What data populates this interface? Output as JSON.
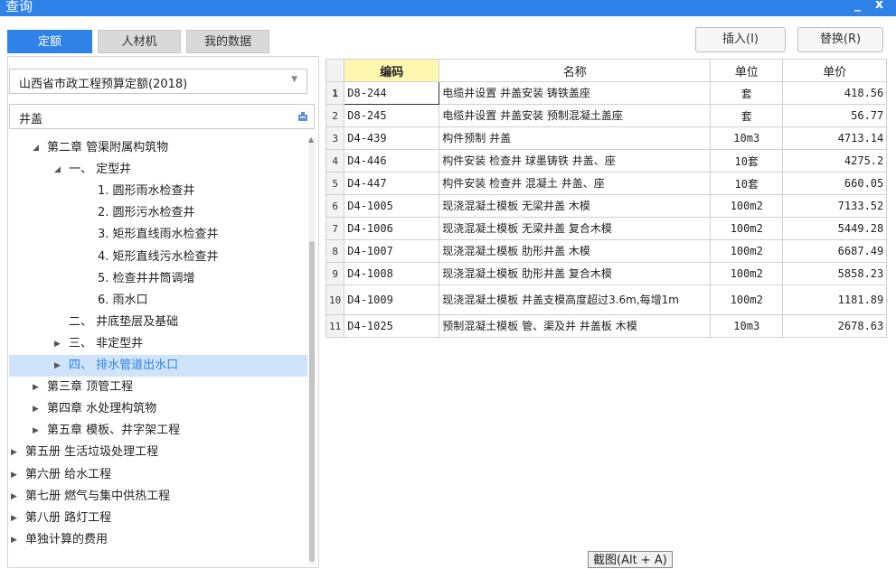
{
  "window": {
    "title": "查询",
    "minimize": "_",
    "close": "x"
  },
  "tabs": [
    {
      "label": "定额",
      "active": true
    },
    {
      "label": "人材机",
      "active": false
    },
    {
      "label": "我的数据",
      "active": false
    }
  ],
  "actions": {
    "insert": "插入(I)",
    "replace": "替换(R)"
  },
  "selector": {
    "value": "山西省市政工程预算定额(2018)"
  },
  "search": {
    "value": "井盖",
    "icon": "search-icon"
  },
  "tree": [
    {
      "toggle": "◢",
      "label": "第二章 管渠附属构筑物",
      "level": 2
    },
    {
      "toggle": "◢",
      "label": "一、 定型井",
      "level": 3
    },
    {
      "toggle": "",
      "label": "1. 圆形雨水检查井",
      "level": 4
    },
    {
      "toggle": "",
      "label": "2. 圆形污水检查井",
      "level": 4
    },
    {
      "toggle": "",
      "label": "3. 矩形直线雨水检查井",
      "level": 4
    },
    {
      "toggle": "",
      "label": "4. 矩形直线污水检查井",
      "level": 4
    },
    {
      "toggle": "",
      "label": "5. 检查井井筒调增",
      "level": 4
    },
    {
      "toggle": "",
      "label": "6. 雨水口",
      "level": 4
    },
    {
      "toggle": "",
      "label": "二、 井底垫层及基础",
      "level": 3
    },
    {
      "toggle": "▶",
      "label": "三、 非定型井",
      "level": 3
    },
    {
      "toggle": "▶",
      "label": "四、 排水管道出水口",
      "level": 3,
      "selected": true
    },
    {
      "toggle": "▶",
      "label": "第三章 顶管工程",
      "level": 2
    },
    {
      "toggle": "▶",
      "label": "第四章 水处理构筑物",
      "level": 2
    },
    {
      "toggle": "▶",
      "label": "第五章 模板、井字架工程",
      "level": 2
    },
    {
      "toggle": "▶",
      "label": "第五册 生活垃圾处理工程",
      "level": 1
    },
    {
      "toggle": "▶",
      "label": "第六册 给水工程",
      "level": 1
    },
    {
      "toggle": "▶",
      "label": "第七册 燃气与集中供热工程",
      "level": 1
    },
    {
      "toggle": "▶",
      "label": "第八册 路灯工程",
      "level": 1
    },
    {
      "toggle": "▶",
      "label": "单独计算的费用",
      "level": 1
    }
  ],
  "grid": {
    "headers": {
      "code": "编码",
      "name": "名称",
      "unit": "单位",
      "price": "单价"
    },
    "rows": [
      {
        "idx": "1",
        "code": "D8-244",
        "name": "电缆井设置 井盖安装 铸铁盖座",
        "unit": "套",
        "price": "418.56"
      },
      {
        "idx": "2",
        "code": "D8-245",
        "name": "电缆井设置 井盖安装 预制混凝土盖座",
        "unit": "套",
        "price": "56.77"
      },
      {
        "idx": "3",
        "code": "D4-439",
        "name": "构件预制 井盖",
        "unit": "10m3",
        "price": "4713.14"
      },
      {
        "idx": "4",
        "code": "D4-446",
        "name": "构件安装 检查井 球墨铸铁 井盖、座",
        "unit": "10套",
        "price": "4275.2"
      },
      {
        "idx": "5",
        "code": "D4-447",
        "name": "构件安装 检查井 混凝土 井盖、座",
        "unit": "10套",
        "price": "660.05"
      },
      {
        "idx": "6",
        "code": "D4-1005",
        "name": "现浇混凝土模板 无梁井盖 木模",
        "unit": "100m2",
        "price": "7133.52"
      },
      {
        "idx": "7",
        "code": "D4-1006",
        "name": "现浇混凝土模板 无梁井盖 复合木模",
        "unit": "100m2",
        "price": "5449.28"
      },
      {
        "idx": "8",
        "code": "D4-1007",
        "name": "现浇混凝土模板 肋形井盖 木模",
        "unit": "100m2",
        "price": "6687.49"
      },
      {
        "idx": "9",
        "code": "D4-1008",
        "name": "现浇混凝土模板 肋形井盖 复合木模",
        "unit": "100m2",
        "price": "5858.23"
      },
      {
        "idx": "10",
        "code": "D4-1009",
        "name": "现浇混凝土模板 井盖支模高度超过3.6m,每增1m",
        "unit": "100m2",
        "price": "1181.89"
      },
      {
        "idx": "11",
        "code": "D4-1025",
        "name": "预制混凝土模板 管、渠及井 井盖板 木模",
        "unit": "10m3",
        "price": "2678.63"
      }
    ]
  },
  "tooltip": "截图(Alt + A)"
}
